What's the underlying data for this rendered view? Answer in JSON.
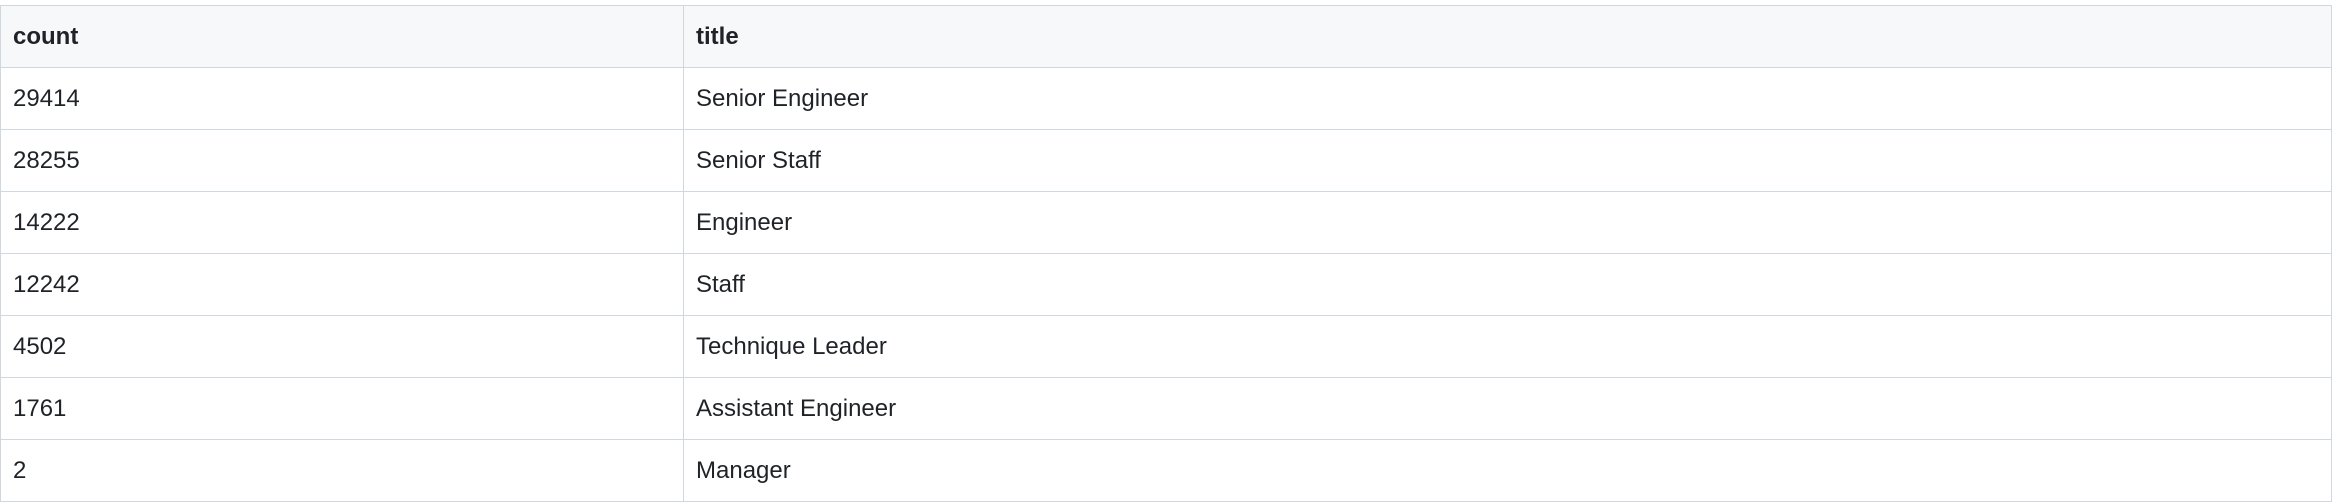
{
  "table": {
    "columns": [
      "count",
      "title"
    ],
    "rows": [
      [
        "29414",
        "Senior Engineer"
      ],
      [
        "28255",
        "Senior Staff"
      ],
      [
        "14222",
        "Engineer"
      ],
      [
        "12242",
        "Staff"
      ],
      [
        "4502",
        "Technique Leader"
      ],
      [
        "1761",
        "Assistant Engineer"
      ],
      [
        "2",
        "Manager"
      ]
    ]
  },
  "colors": {
    "header_bg": "#f6f8fa",
    "border": "#d0d7de",
    "text": "#1f2328"
  }
}
